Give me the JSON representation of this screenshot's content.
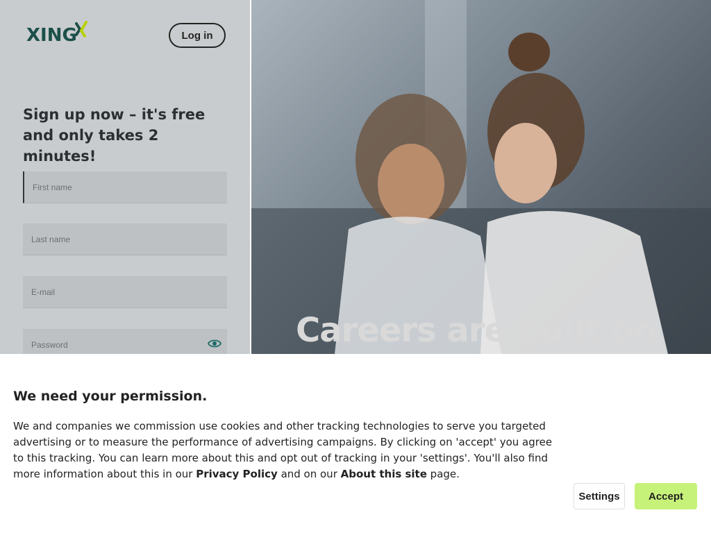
{
  "header": {
    "logo_text": "XING",
    "login_label": "Log in"
  },
  "signup": {
    "heading": "Sign up now – it's free and only takes 2 minutes!",
    "first_name_placeholder": "First name",
    "last_name_placeholder": "Last name",
    "email_placeholder": "E-mail",
    "password_placeholder": "Password"
  },
  "hero": {
    "headline": "Careers are built on"
  },
  "cookie_banner": {
    "heading": "We need your permission.",
    "text_before": "We and companies we commission use cookies and other tracking technologies to serve you targeted advertising or to measure the performance of advertising campaigns. By clicking on 'accept' you agree to this tracking. You can learn more about this and opt out of tracking in your 'settings'. You'll also find more information about this in our ",
    "privacy_link": "Privacy Policy",
    "text_middle": " and on our ",
    "about_link": "About this site",
    "text_after": " page.",
    "settings_label": "Settings",
    "accept_label": "Accept"
  },
  "colors": {
    "brand": "#1b4f4a",
    "accept": "#c7f27a"
  }
}
